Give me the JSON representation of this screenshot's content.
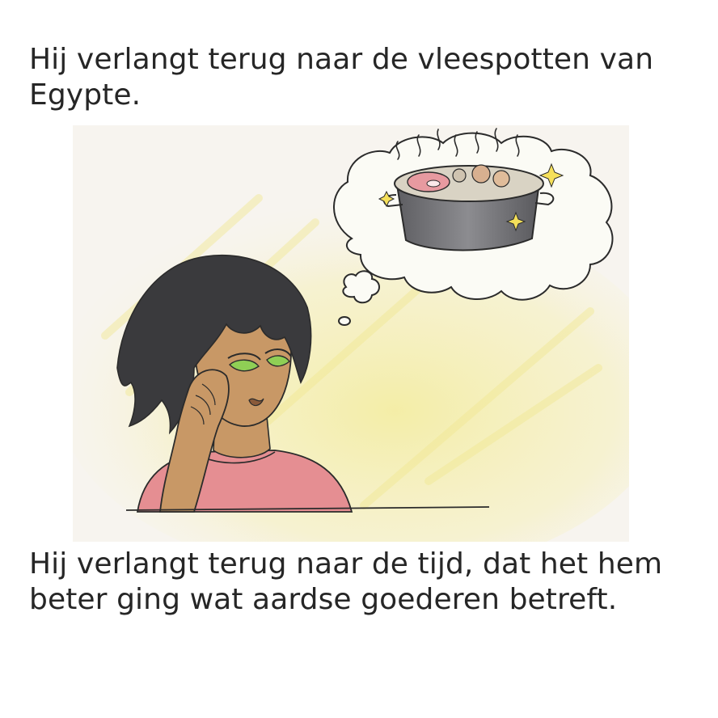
{
  "top_caption": "Hij verlangt terug naar de vleespotten van Egypte.",
  "bottom_caption": "Hij verlangt terug naar de tijd, dat het hem beter ging wat aardse goederen betreft.",
  "illustration": {
    "subject": "person-dreaming-of-cooking-pot",
    "colors": {
      "paper": "#f7f4ef",
      "yellow_wash": "#f3ec9a",
      "hair": "#3a3a3d",
      "skin": "#c89866",
      "shirt": "#e58e92",
      "eyes": "#8fcf55",
      "pot": "#7d7d80"
    }
  }
}
